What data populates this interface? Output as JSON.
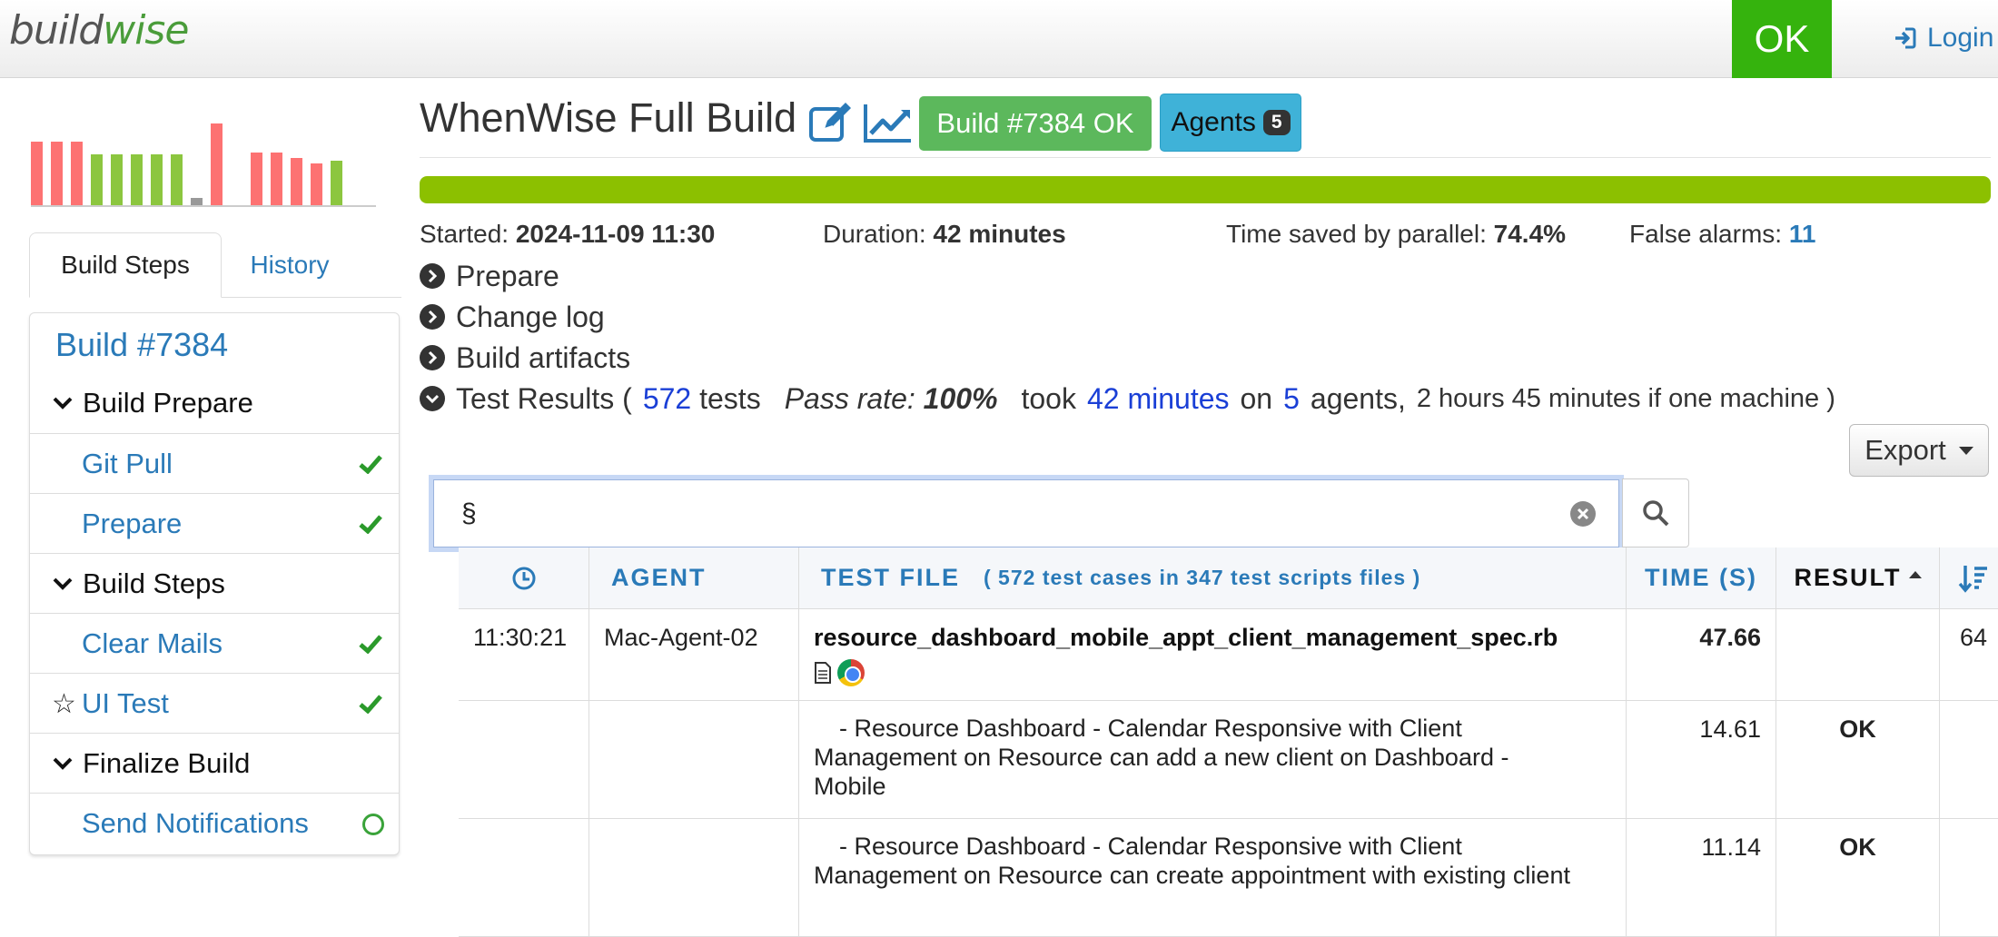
{
  "nav": {
    "logo_part1": "build",
    "logo_part2": "wise",
    "status": "OK",
    "login": "Login"
  },
  "sidebar": {
    "mini_chart": {
      "bars": [
        {
          "level": 0.6,
          "color": "#fd7272"
        },
        {
          "level": 0.6,
          "color": "#fd7272"
        },
        {
          "level": 0.6,
          "color": "#fd7272"
        },
        {
          "level": 0.48,
          "color": "#8cc63f"
        },
        {
          "level": 0.48,
          "color": "#8cc63f"
        },
        {
          "level": 0.48,
          "color": "#8cc63f"
        },
        {
          "level": 0.48,
          "color": "#8cc63f"
        },
        {
          "level": 0.48,
          "color": "#8cc63f"
        },
        {
          "level": 0.07,
          "color": "#999999"
        },
        {
          "level": 0.78,
          "color": "#fd7272"
        },
        {
          "level": 0.0,
          "color": "#ffffff"
        },
        {
          "level": 0.5,
          "color": "#fd7272"
        },
        {
          "level": 0.5,
          "color": "#fd7272"
        },
        {
          "level": 0.45,
          "color": "#fd7272"
        },
        {
          "level": 0.4,
          "color": "#fd7272"
        },
        {
          "level": 0.42,
          "color": "#8cc63f"
        }
      ]
    },
    "tabs": {
      "active": "Build Steps",
      "other": "History"
    },
    "panel_title": "Build #7384",
    "groups": [
      {
        "label": "Build Prepare",
        "items": [
          {
            "label": "Git Pull",
            "status": "done"
          },
          {
            "label": "Prepare",
            "status": "done"
          }
        ]
      },
      {
        "label": "Build Steps",
        "items": [
          {
            "label": "Clear Mails",
            "status": "done"
          },
          {
            "label": "UI Test",
            "status": "done"
          }
        ]
      },
      {
        "label": "Finalize Build",
        "items": [
          {
            "label": "Send Notifications",
            "status": "pending"
          }
        ]
      }
    ]
  },
  "header": {
    "title": "WhenWise Full Build",
    "build_badge": "Build #7384 OK",
    "agents_label": "Agents",
    "agents_count": "5",
    "progress_fraction": 1.0
  },
  "info": {
    "started_label": "Started:",
    "started_value": "2024-11-09 11:30",
    "duration_label": "Duration:",
    "duration_value": "42 minutes",
    "saved_label": "Time saved by parallel:",
    "saved_value": "74.4%",
    "false_alarms_label": "False alarms:",
    "false_alarms_value": "11"
  },
  "sections": {
    "prepare": "Prepare",
    "changelog": "Change log",
    "artifacts": "Build artifacts",
    "test_results": {
      "label": "Test Results (",
      "tests_count": "572",
      "tests_word": "tests",
      "pass_rate_label": "Pass rate:",
      "pass_rate_value": "100%",
      "took": "took",
      "took_value": "42 minutes",
      "on": "on",
      "agents_value": "5",
      "agents_tail": "agents,",
      "one_machine": "2 hours 45 minutes if one machine )"
    }
  },
  "export": "Export",
  "search": {
    "value": "§"
  },
  "table": {
    "headers": {
      "agent": "AGENT",
      "test_file": "TEST FILE",
      "test_file_sub": "( 572 test cases in 347 test scripts files )",
      "time": "TIME (S)",
      "result": "RESULT"
    },
    "rows": [
      {
        "time": "11:30:21",
        "agent": "Mac-Agent-02",
        "file": "resource_dashboard_mobile_appt_client_management_spec.rb",
        "duration": "47.66",
        "result": "",
        "extra": "64"
      },
      {
        "time": "",
        "agent": "",
        "file": "- Resource Dashboard - Calendar Responsive with Client Management on Resource can add a new client on Dashboard - Mobile",
        "duration": "14.61",
        "result": "OK",
        "extra": ""
      },
      {
        "time": "",
        "agent": "",
        "file": "- Resource Dashboard - Calendar Responsive with Client Management on Resource can create appointment with existing client",
        "duration": "11.14",
        "result": "OK",
        "extra": ""
      }
    ]
  }
}
